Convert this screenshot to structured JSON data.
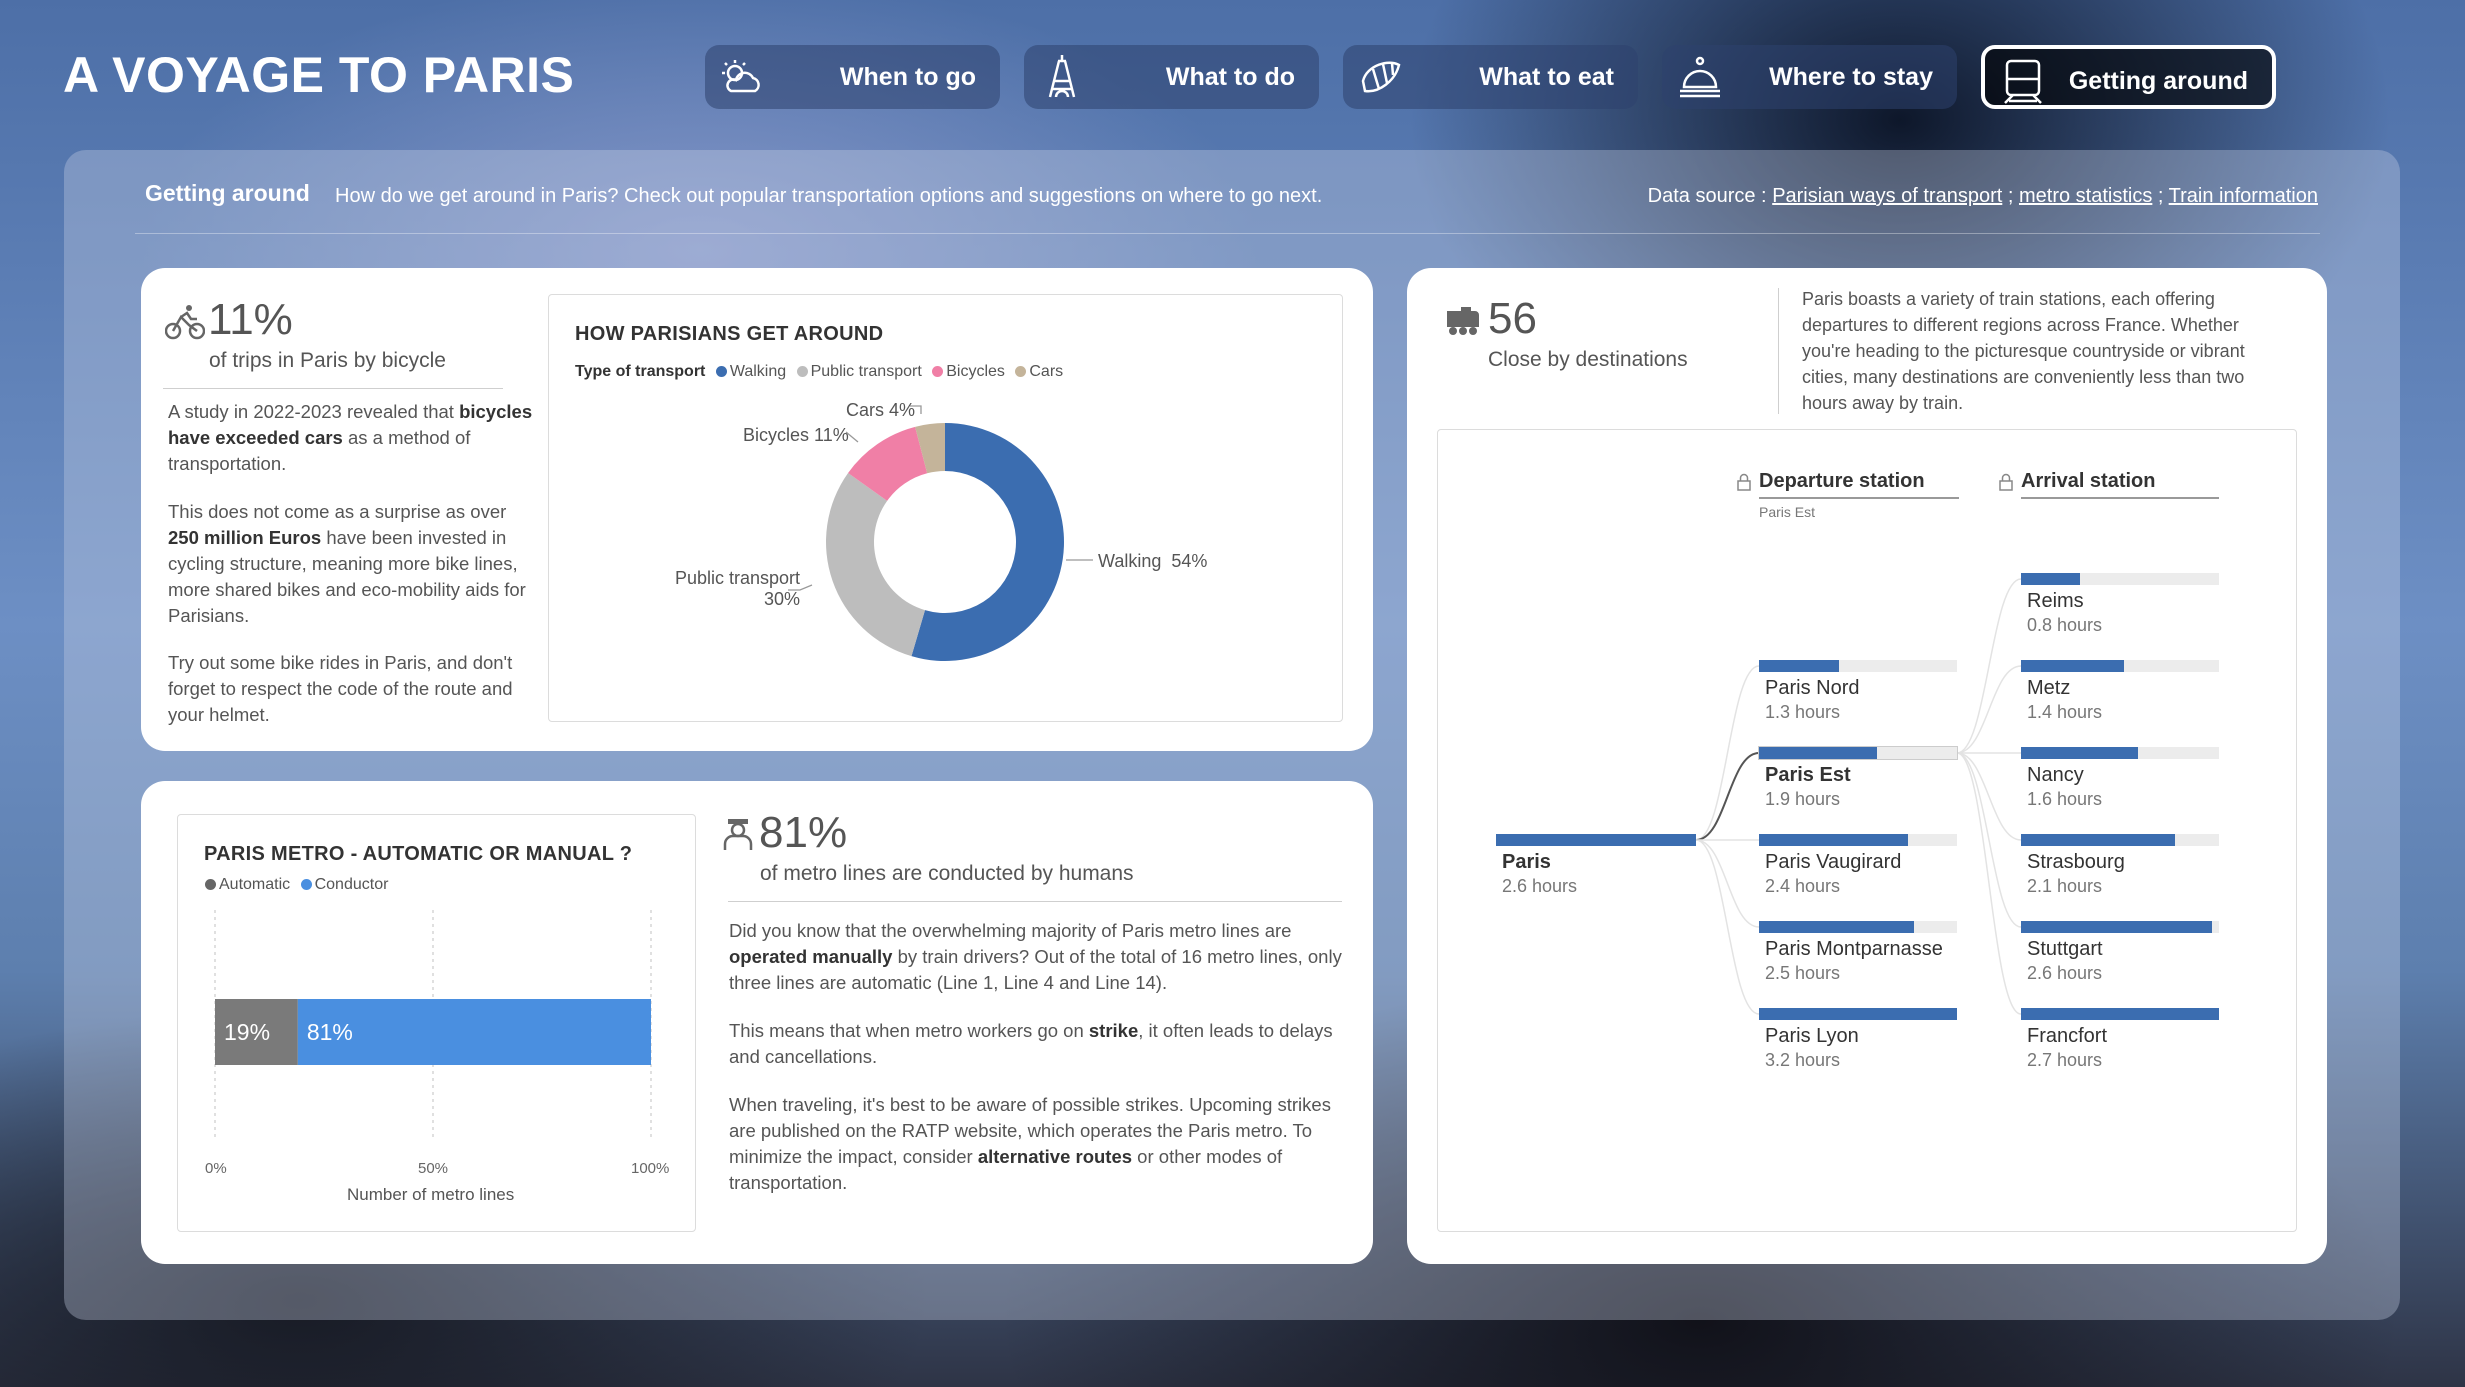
{
  "header": {
    "title": "A VOYAGE TO PARIS"
  },
  "nav": [
    {
      "label": "When to go",
      "icon": "weather-icon"
    },
    {
      "label": "What to do",
      "icon": "eiffel-tower-icon"
    },
    {
      "label": "What to eat",
      "icon": "croissant-icon"
    },
    {
      "label": "Where to stay",
      "icon": "hotel-bell-icon"
    },
    {
      "label": "Getting around",
      "icon": "train-icon",
      "active": true
    }
  ],
  "subheader": {
    "title": "Getting around",
    "description": "How do we get around in Paris? Check out popular transportation options and suggestions on where to go next.",
    "source_prefix": "Data source :",
    "links": [
      "Parisian ways of transport",
      "metro statistics",
      "Train information"
    ],
    "sep": ";"
  },
  "bicycle": {
    "kpi": "11%",
    "kpi_label": "of trips in Paris by bicycle",
    "p1": [
      "A study in 2022-2023 revealed that ",
      "bicycles have exceeded cars",
      " as a method of transportation."
    ],
    "p2": [
      "This does not come as a surprise as over ",
      "250 million Euros",
      " have been invested in cycling structure, meaning more bike lines, more shared bikes and eco-mobility aids for Parisians."
    ],
    "p3": "Try out some bike rides in Paris, and don't forget to respect the code of the route and your helmet."
  },
  "transport_chart": {
    "title": "HOW PARISIANS GET AROUND",
    "legend_title": "Type of transport",
    "labels": {
      "walking": "Walking",
      "walking_pct": "54%",
      "public": "Public transport",
      "public_pct": "30%",
      "bicycles": "Bicycles 11%",
      "cars": "Cars 4%"
    }
  },
  "metro_chart": {
    "title": "PARIS METRO - AUTOMATIC OR MANUAL ?",
    "xlabel": "Number of metro lines",
    "ticks": [
      "0%",
      "50%",
      "100%"
    ]
  },
  "metro": {
    "kpi": "81%",
    "kpi_label": "of metro lines are conducted by humans",
    "p1": [
      "Did you know that the overwhelming majority of Paris metro lines are ",
      "operated manually",
      " by train drivers? Out of the total of 16 metro lines, only three lines are automatic (Line 1, Line 4 and Line 14)."
    ],
    "p2": [
      "This means that when metro workers go on ",
      "strike",
      ", it often leads to delays and cancellations."
    ],
    "p3": [
      "When traveling, it's best to be aware of possible strikes. Upcoming strikes are published on the RATP website, which operates the Paris metro. To minimize the impact, consider ",
      "alternative routes",
      " or other modes of transportation."
    ]
  },
  "destinations": {
    "kpi": "56",
    "kpi_label": "Close by destinations",
    "description": "Paris boasts a variety of train stations, each offering departures to different regions across France. Whether you're heading to the picturesque countryside or vibrant cities, many destinations are conveniently less than two hours away by train.",
    "departure_header": "Departure station",
    "departure_filter": "Paris Est",
    "arrival_header": "Arrival station",
    "root": {
      "name": "Paris",
      "value": "2.6 hours"
    },
    "departures": [
      {
        "name": "Paris Nord",
        "value": "1.3 hours",
        "hours": 1.3
      },
      {
        "name": "Paris Est",
        "value": "1.9 hours",
        "hours": 1.9,
        "selected": true
      },
      {
        "name": "Paris Vaugirard",
        "value": "2.4 hours",
        "hours": 2.4
      },
      {
        "name": "Paris Montparnasse",
        "value": "2.5 hours",
        "hours": 2.5
      },
      {
        "name": "Paris Lyon",
        "value": "3.2 hours",
        "hours": 3.2
      }
    ],
    "arrivals": [
      {
        "name": "Reims",
        "value": "0.8 hours",
        "hours": 0.8
      },
      {
        "name": "Metz",
        "value": "1.4 hours",
        "hours": 1.4
      },
      {
        "name": "Nancy",
        "value": "1.6 hours",
        "hours": 1.6
      },
      {
        "name": "Strasbourg",
        "value": "2.1 hours",
        "hours": 2.1
      },
      {
        "name": "Stuttgart",
        "value": "2.6 hours",
        "hours": 2.6
      },
      {
        "name": "Francfort",
        "value": "2.7 hours",
        "hours": 2.7
      }
    ]
  },
  "colors": {
    "walking": "#3b6db0",
    "public_transport": "#bdbdbd",
    "bicycles": "#f07fa6",
    "cars": "#c4b49a",
    "automatic": "#7a7a7a",
    "conductor": "#4a8fe0",
    "tree_bar": "#3b6db0"
  },
  "chart_data": [
    {
      "type": "pie",
      "title": "HOW PARISIANS GET AROUND",
      "legend_title": "Type of transport",
      "categories": [
        "Walking",
        "Public transport",
        "Bicycles",
        "Cars"
      ],
      "values": [
        54,
        30,
        11,
        4
      ],
      "unit": "%"
    },
    {
      "type": "bar",
      "orientation": "horizontal",
      "stacked": true,
      "title": "PARIS METRO - AUTOMATIC OR MANUAL ?",
      "xlabel": "Number of metro lines",
      "xlim": [
        0,
        100
      ],
      "series": [
        {
          "name": "Automatic",
          "values": [
            19
          ]
        },
        {
          "name": "Conductor",
          "values": [
            81
          ]
        }
      ],
      "unit": "%"
    }
  ]
}
